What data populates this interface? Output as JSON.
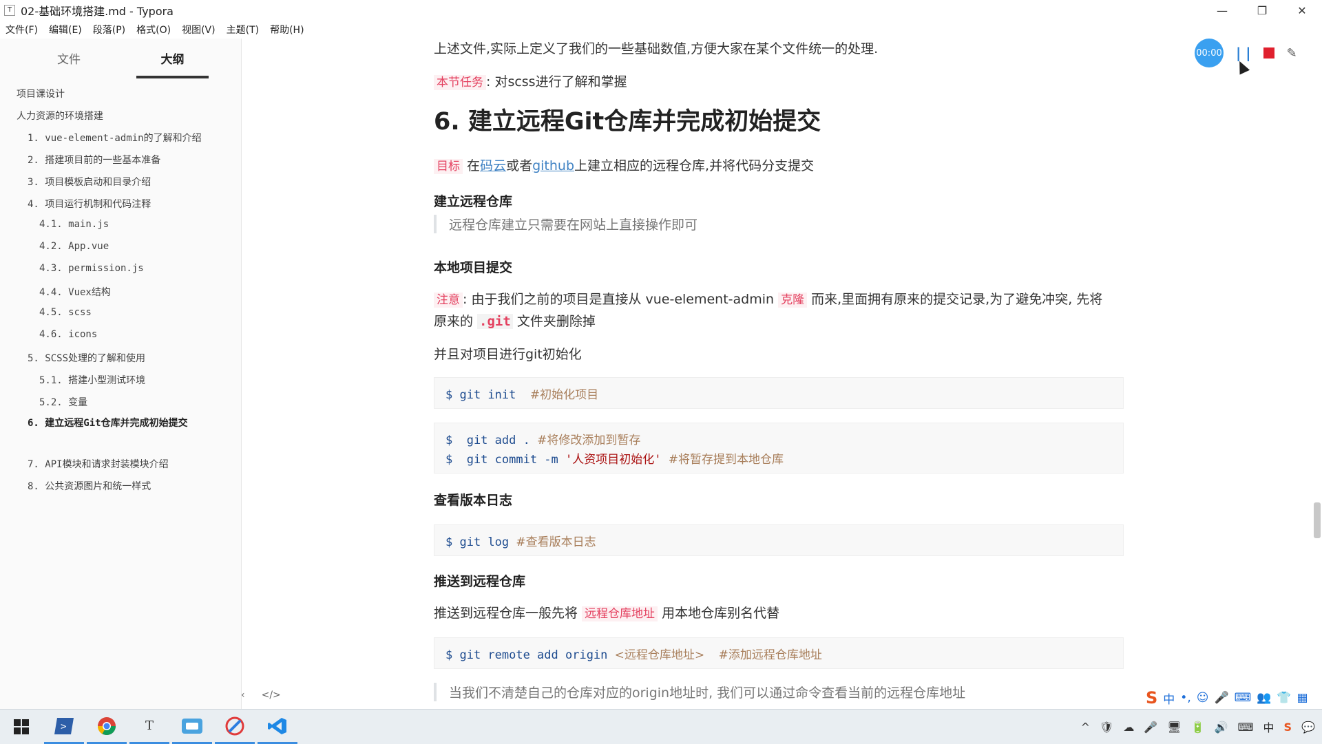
{
  "window": {
    "app_icon": "T",
    "title": "02-基础环境搭建.md - Typora",
    "minimize": "—",
    "maximize": "❐",
    "close": "✕"
  },
  "menu": [
    "文件(F)",
    "编辑(E)",
    "段落(P)",
    "格式(O)",
    "视图(V)",
    "主题(T)",
    "帮助(H)"
  ],
  "sidebar": {
    "tabs": [
      "文件",
      "大纲"
    ],
    "active_tab": "大纲",
    "outline": [
      "项目课设计",
      "人力资源的环境搭建",
      "1.  vue-element-admin的了解和介绍",
      "2.  搭建项目前的一些基本准备",
      "3.  项目模板启动和目录介绍",
      "4.  项目运行机制和代码注释",
      "4.1.  main.js",
      "4.2.  App.vue",
      "4.3.  permission.js",
      "4.4.  Vuex结构",
      "4.5.  scss",
      "4.6.  icons",
      "5.  SCSS处理的了解和使用",
      "5.1.  搭建小型测试环境",
      "5.2.  变量",
      "6.  建立远程Git仓库并完成初始提交",
      "7.  API模块和请求封装模块介绍",
      "8.  公共资源图片和统一样式"
    ],
    "footer_left": "‹",
    "footer_code": "</>"
  },
  "doc": {
    "intro": "上述文件,实际上定义了我们的一些基础数值,方便大家在某个文件统一的处理.",
    "task_tag": "本节任务",
    "task_text": ":  对scss进行了解和掌握",
    "heading": "6. 建立远程Git仓库并完成初始提交",
    "goal_tag": "目标",
    "goal_pre": "在",
    "goal_link1": "码云",
    "goal_mid": "或者",
    "goal_link2": "github",
    "goal_post": "上建立相应的远程仓库,并将代码分支提交",
    "h_remote": "建立远程仓库",
    "quote_remote": "远程仓库建立只需要在网站上直接操作即可",
    "h_local": "本地项目提交",
    "note_tag": "注意",
    "note_text1": ": 由于我们之前的项目是直接从 vue-element-admin ",
    "note_tag2": "克隆",
    "note_text2": " 而来,里面拥有原来的提交记录,为了避免冲突, 先将",
    "note_text3": "原来的 ",
    "note_code": ".git",
    "note_text4": " 文件夹删除掉",
    "git_init_text": "并且对项目进行git初始化",
    "code1": {
      "cmd": "$ git init",
      "comment": "#初始化项目"
    },
    "code2a": {
      "cmd": "$  git add .",
      "comment": "#将修改添加到暂存"
    },
    "code2b": {
      "cmd": "$  git commit -m ",
      "str": "'人资项目初始化'",
      "comment": "#将暂存提到本地仓库"
    },
    "h_log": "查看版本日志",
    "code3": {
      "cmd": "$ git log",
      "comment": "#查看版本日志"
    },
    "h_push": "推送到远程仓库",
    "push_text1": "推送到远程仓库一般先将 ",
    "push_tag": "远程仓库地址",
    "push_text2": " 用本地仓库别名代替",
    "code4": {
      "cmd": "$ git remote add origin ",
      "arg": "<远程仓库地址>",
      "comment": "#添加远程仓库地址"
    },
    "quote_origin": "当我们不清楚自己的仓库对应的origin地址时, 我们可以通过命令查看当前的远程仓库地址"
  },
  "recorder": {
    "timer": "00:00",
    "pause": "| |"
  },
  "ime": {
    "logo": "S",
    "items": [
      "中",
      "•,",
      "☺",
      "🎤",
      "⌨",
      "👥",
      "👕",
      "▦"
    ]
  },
  "taskbar": {
    "apps": [
      "windows-start",
      "powershell",
      "chrome",
      "typora",
      "file-manager",
      "feishu",
      "vscode"
    ],
    "tray_items": [
      "^",
      "🛡",
      "☁",
      "🎤",
      "🖥",
      "🔋",
      "🔊",
      "⌨",
      "中",
      "S",
      "💬"
    ]
  }
}
